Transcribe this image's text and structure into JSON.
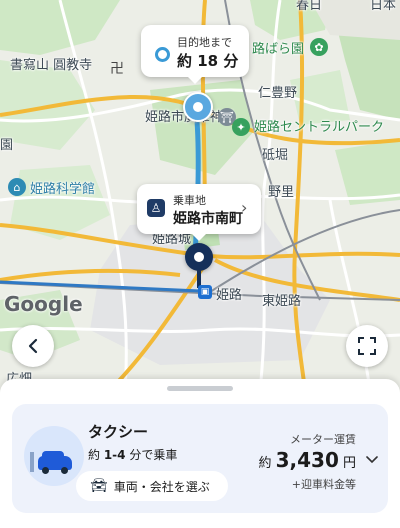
{
  "map": {
    "labels": {
      "kakiyama": "書寫山 圓教寺",
      "hiroshi_jinja": "姫路市廣峯神社",
      "hiroshi_bara": "路ばら園",
      "nitoyo": "仁豊野",
      "central_park": "姫路セントラルパーク",
      "toneori": "砥堀",
      "nozato": "野里",
      "science": "姫路科学館",
      "castle": "姫路城",
      "himeji": "姫路",
      "higashi_himeji": "東姫路",
      "hiro": "広畑",
      "en": "園",
      "kasuga": "春日",
      "nihon": "日本",
      "google": "Google"
    }
  },
  "destination_callout": {
    "title": "目的地まで",
    "value": "約 18 分"
  },
  "pickup_callout": {
    "title": "乗車地",
    "value": "姫路市南町"
  },
  "taxi_card": {
    "service_name": "タクシー",
    "eta_prefix": "約 ",
    "eta_value": "1-4",
    "eta_suffix": " 分で乗車",
    "choose_label": "車両・会社を選ぶ",
    "fare_label": "メーター運賃",
    "fare_prefix": "約 ",
    "fare_value": "3,430",
    "fare_unit": " 円",
    "extra_fee": "+迎車料金等"
  },
  "colors": {
    "accent": "#1f5bd8",
    "route": "#3a9ad6",
    "expressway": "#f2b938",
    "park": "#cfe8c5"
  }
}
